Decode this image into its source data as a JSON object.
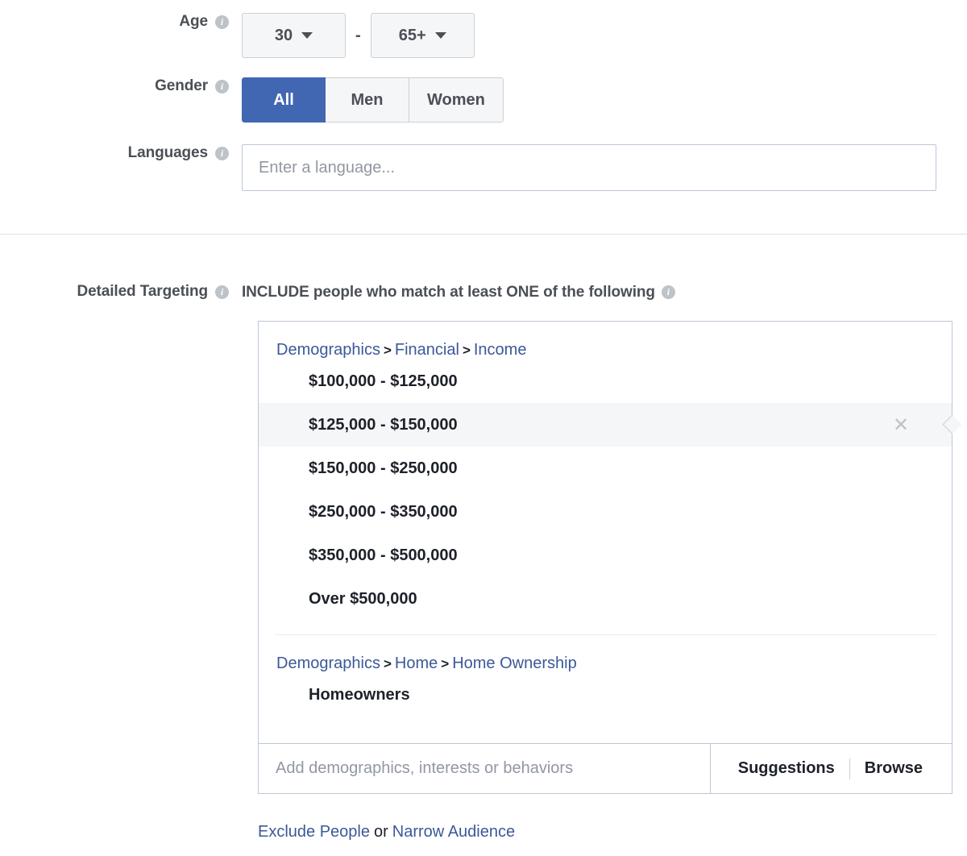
{
  "form": {
    "age": {
      "label": "Age",
      "info_icon": "info-icon",
      "min_value": "30",
      "max_value": "65+",
      "separator": "-",
      "caret_icon": "chevron-down-icon"
    },
    "gender": {
      "label": "Gender",
      "info_icon": "info-icon",
      "options": [
        {
          "label": "All",
          "selected": true
        },
        {
          "label": "Men",
          "selected": false
        },
        {
          "label": "Women",
          "selected": false
        }
      ]
    },
    "languages": {
      "label": "Languages",
      "info_icon": "info-icon",
      "value": "",
      "placeholder": "Enter a language..."
    }
  },
  "detailed_targeting": {
    "label": "Detailed Targeting",
    "info_icon": "info-icon",
    "heading": "INCLUDE people who match at least ONE of the following",
    "heading_info_icon": "info-icon",
    "groups": [
      {
        "path": [
          "Demographics",
          "Financial",
          "Income"
        ],
        "path_separator": ">",
        "items": [
          {
            "label": "$100,000 - $125,000",
            "highlighted": false
          },
          {
            "label": "$125,000 - $150,000",
            "highlighted": true,
            "remove_icon": "✕"
          },
          {
            "label": "$150,000 - $250,000",
            "highlighted": false
          },
          {
            "label": "$250,000 - $350,000",
            "highlighted": false
          },
          {
            "label": "$350,000 - $500,000",
            "highlighted": false
          },
          {
            "label": "Over $500,000",
            "highlighted": false
          }
        ]
      },
      {
        "path": [
          "Demographics",
          "Home",
          "Home Ownership"
        ],
        "path_separator": ">",
        "items": [
          {
            "label": "Homeowners",
            "highlighted": false
          }
        ]
      }
    ],
    "search": {
      "value": "",
      "placeholder": "Add demographics, interests or behaviors",
      "suggestions_label": "Suggestions",
      "browse_label": "Browse"
    },
    "footer": {
      "exclude_label": "Exclude People",
      "conjunction": "or",
      "narrow_label": "Narrow Audience"
    }
  },
  "colors": {
    "brand_blue": "#4267b2",
    "link_blue": "#3b5998",
    "label_gray": "#4b4f56",
    "text_dark": "#1d2129",
    "placeholder_gray": "#9197a3",
    "border_blue_gray": "#bdc7d8",
    "highlight_bg": "#f5f6f7",
    "divider": "#dddfe2"
  }
}
